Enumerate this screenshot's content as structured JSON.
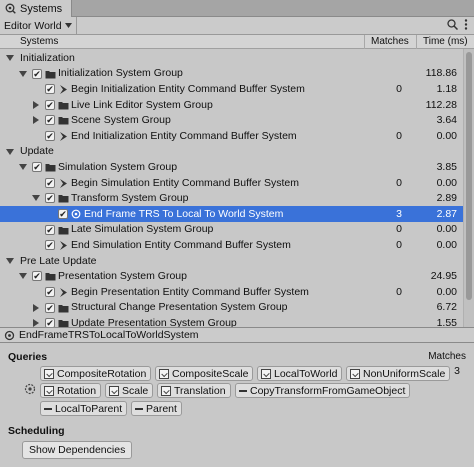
{
  "window": {
    "tab_title": "Systems",
    "tab_icon": "systems-window-icon"
  },
  "toolbar": {
    "world": "Editor World",
    "icons": [
      "search-icon",
      "more-options-icon"
    ]
  },
  "columns": {
    "systems": "Systems",
    "matches": "Matches",
    "time": "Time (ms)"
  },
  "tree": [
    {
      "label": "Initialization",
      "level": 0,
      "kind": "world",
      "expanded": true
    },
    {
      "label": "Initialization System Group",
      "level": 1,
      "kind": "group",
      "checked": true,
      "expanded": true,
      "matches": "",
      "time": "118.86"
    },
    {
      "label": "Begin Initialization Entity Command Buffer System",
      "level": 2,
      "kind": "ecb",
      "checked": true,
      "matches": "0",
      "time": "1.18"
    },
    {
      "label": "Live Link Editor System Group",
      "level": 2,
      "kind": "group",
      "checked": true,
      "expanded": false,
      "matches": "",
      "time": "112.28"
    },
    {
      "label": "Scene System Group",
      "level": 2,
      "kind": "group",
      "checked": true,
      "expanded": false,
      "matches": "",
      "time": "3.64"
    },
    {
      "label": "End Initialization Entity Command Buffer System",
      "level": 2,
      "kind": "ecb",
      "checked": true,
      "matches": "0",
      "time": "0.00"
    },
    {
      "label": "Update",
      "level": 0,
      "kind": "world",
      "expanded": true
    },
    {
      "label": "Simulation System Group",
      "level": 1,
      "kind": "group",
      "checked": true,
      "expanded": true,
      "matches": "",
      "time": "3.85"
    },
    {
      "label": "Begin Simulation Entity Command Buffer System",
      "level": 2,
      "kind": "ecb",
      "checked": true,
      "matches": "0",
      "time": "0.00"
    },
    {
      "label": "Transform System Group",
      "level": 2,
      "kind": "group",
      "checked": true,
      "expanded": true,
      "matches": "",
      "time": "2.89"
    },
    {
      "label": "End Frame TRS To Local To World System",
      "level": 3,
      "kind": "system",
      "checked": true,
      "selected": true,
      "matches": "3",
      "time": "2.87"
    },
    {
      "label": "Late Simulation System Group",
      "level": 2,
      "kind": "group",
      "checked": true,
      "matches": "0",
      "time": "0.00"
    },
    {
      "label": "End Simulation Entity Command Buffer System",
      "level": 2,
      "kind": "ecb",
      "checked": true,
      "matches": "0",
      "time": "0.00"
    },
    {
      "label": "Pre Late Update",
      "level": 0,
      "kind": "world",
      "expanded": true
    },
    {
      "label": "Presentation System Group",
      "level": 1,
      "kind": "group",
      "checked": true,
      "expanded": true,
      "matches": "",
      "time": "24.95"
    },
    {
      "label": "Begin Presentation Entity Command Buffer System",
      "level": 2,
      "kind": "ecb",
      "checked": true,
      "matches": "0",
      "time": "0.00"
    },
    {
      "label": "Structural Change Presentation System Group",
      "level": 2,
      "kind": "group",
      "checked": true,
      "expanded": false,
      "matches": "",
      "time": "6.72"
    },
    {
      "label": "Update Presentation System Group",
      "level": 2,
      "kind": "group",
      "checked": true,
      "expanded": false,
      "matches": "",
      "time": "1.55"
    }
  ],
  "path": {
    "label": "EndFrameTRSToLocalToWorldSystem"
  },
  "queries": {
    "title": "Queries",
    "matches_label": "Matches",
    "matches_value": "3",
    "query_icon": "query-icon",
    "components": [
      {
        "label": "CompositeRotation",
        "access": "write"
      },
      {
        "label": "CompositeScale",
        "access": "write"
      },
      {
        "label": "LocalToWorld",
        "access": "write"
      },
      {
        "label": "NonUniformScale",
        "access": "write"
      },
      {
        "label": "Rotation",
        "access": "write"
      },
      {
        "label": "Scale",
        "access": "write"
      },
      {
        "label": "Translation",
        "access": "write"
      },
      {
        "label": "CopyTransformFromGameObject",
        "access": "exclude"
      },
      {
        "label": "LocalToParent",
        "access": "exclude"
      },
      {
        "label": "Parent",
        "access": "exclude"
      }
    ]
  },
  "scheduling": {
    "title": "Scheduling",
    "button": "Show Dependencies"
  }
}
